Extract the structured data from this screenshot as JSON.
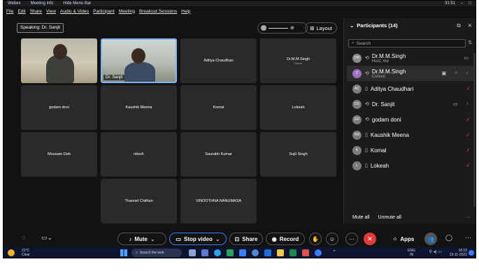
{
  "titlebar": {
    "app_name": "Webex",
    "meeting_info": "Meeting info",
    "hide_menu": "Hide Menu Bar",
    "time": "31:51"
  },
  "menu": [
    "File",
    "Edit",
    "Share",
    "View",
    "Audio & Video",
    "Participant",
    "Meeting",
    "Breakout Sessions",
    "Help"
  ],
  "speaking": "Speaking: Dr. Sanjit",
  "layout_label": "Layout",
  "video_tiles": [
    {
      "name": ""
    },
    {
      "name": "Dr. Sanjit"
    }
  ],
  "name_tiles": [
    {
      "name": "Aditya Chaudhari",
      "sub": ""
    },
    {
      "name": "Dr.M.M.Singh",
      "sub": "Cohost"
    },
    {
      "name": "godam doni",
      "sub": ""
    },
    {
      "name": "Kaushik Meena",
      "sub": ""
    },
    {
      "name": "Komal",
      "sub": ""
    },
    {
      "name": "Lokeah",
      "sub": ""
    },
    {
      "name": "Mousam Deb",
      "sub": ""
    },
    {
      "name": "nitesh",
      "sub": ""
    },
    {
      "name": "Saurabh Kumar",
      "sub": ""
    },
    {
      "name": "Sujit Singh",
      "sub": ""
    },
    {
      "name": "Thannel Chithan",
      "sub": ""
    },
    {
      "name": "VINOOTHNA NANUMASA",
      "sub": ""
    }
  ],
  "participants_panel": {
    "title": "Participants (14)",
    "search_placeholder": "Search",
    "participants": [
      {
        "initials": "DR",
        "name": "Dr.M.M.Singh",
        "role": "Host, me"
      },
      {
        "initials": "D",
        "name": "Dr.M.M.Singh",
        "role": "Cohost"
      },
      {
        "initials": "AC",
        "name": "Aditya Chaudhari",
        "role": ""
      },
      {
        "initials": "DS",
        "name": "Dr. Sanjit",
        "role": ""
      },
      {
        "initials": "GD",
        "name": "godam doni",
        "role": ""
      },
      {
        "initials": "KM",
        "name": "Kaushik Meena",
        "role": ""
      },
      {
        "initials": "K",
        "name": "Komal",
        "role": ""
      },
      {
        "initials": "L",
        "name": "Lokeah",
        "role": ""
      }
    ],
    "mute_all": "Mute all",
    "unmute_all": "Unmute all"
  },
  "controls": {
    "mute": "Mute",
    "stop_video": "Stop video",
    "share": "Share",
    "record": "Record",
    "apps": "Apps"
  },
  "taskbar": {
    "temperature": "21°C",
    "weather": "Clear",
    "search": "Search the web",
    "lang_top": "ENG",
    "lang_bottom": "IN",
    "time": "18:10",
    "date": "23-11-2022"
  }
}
